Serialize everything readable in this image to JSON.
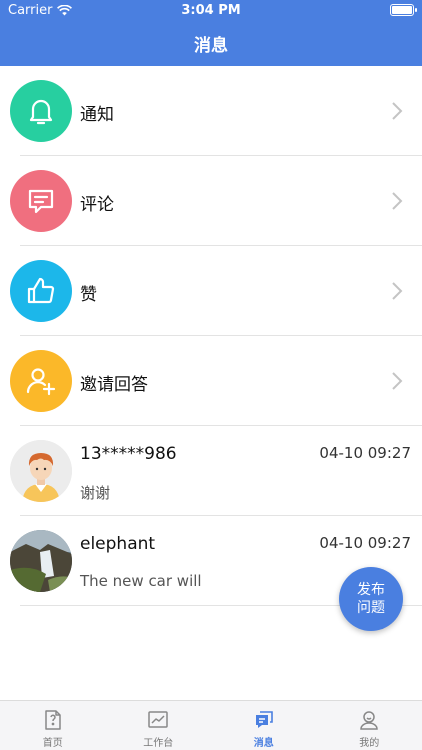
{
  "status_bar": {
    "carrier": "Carrier",
    "time": "3:04 PM"
  },
  "nav": {
    "title": "消息"
  },
  "categories": [
    {
      "label": "通知",
      "icon": "bell-icon",
      "color": "#27cfa0"
    },
    {
      "label": "评论",
      "icon": "comment-icon",
      "color": "#f06f7f"
    },
    {
      "label": "赞",
      "icon": "thumbs-up-icon",
      "color": "#1cb7ea"
    },
    {
      "label": "邀请回答",
      "icon": "invite-user-icon",
      "color": "#fbb829"
    }
  ],
  "messages": [
    {
      "name": "13*****986",
      "time": "04-10 09:27",
      "preview": "谢谢"
    },
    {
      "name": "elephant",
      "time": "04-10 09:27",
      "preview": "The new car will"
    }
  ],
  "fab": {
    "line1": "发布",
    "line2": "问题"
  },
  "tabs": [
    {
      "label": "首页",
      "icon": "question-doc-icon",
      "active": false
    },
    {
      "label": "工作台",
      "icon": "chart-icon",
      "active": false
    },
    {
      "label": "消息",
      "icon": "message-icon",
      "active": true
    },
    {
      "label": "我的",
      "icon": "person-icon",
      "active": false
    }
  ],
  "colors": {
    "primary": "#4a7fe0"
  }
}
